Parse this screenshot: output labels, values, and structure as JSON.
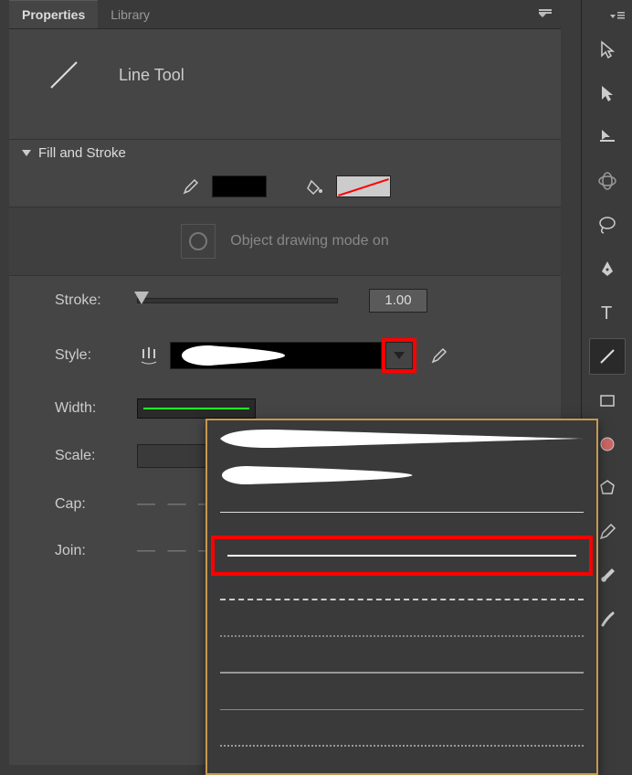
{
  "tabs": {
    "properties": "Properties",
    "library": "Library"
  },
  "tool": {
    "name": "Line Tool"
  },
  "section": {
    "fill_stroke": "Fill and Stroke"
  },
  "obj_draw": {
    "label": "Object drawing mode on"
  },
  "labels": {
    "stroke": "Stroke:",
    "style": "Style:",
    "width": "Width:",
    "scale": "Scale:",
    "cap": "Cap:",
    "join": "Join:"
  },
  "values": {
    "stroke": "1.00"
  },
  "tools": {
    "selection": "selection",
    "subselection": "subselection",
    "free_transform": "free-transform",
    "rotate3d": "3d-rotation",
    "lasso": "lasso",
    "pen": "pen",
    "text": "text",
    "line": "line",
    "rectangle": "rectangle",
    "oval": "oval",
    "polystar": "polystar",
    "pencil": "pencil",
    "brush": "brush",
    "brush2": "paint-brush"
  }
}
